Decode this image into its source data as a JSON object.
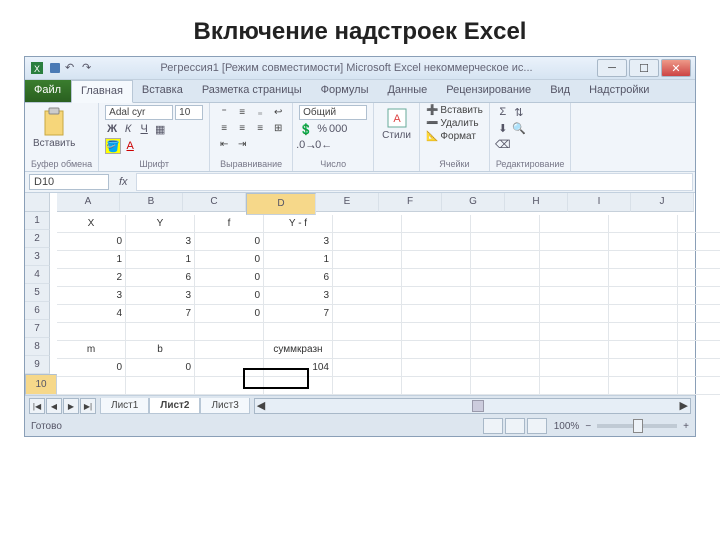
{
  "heading": "Включение надстроек Excel",
  "doctitle": "Регрессия1  [Режим совместимости]   Microsoft Excel некоммерческое ис...",
  "tabs": {
    "file": "Файл",
    "items": [
      "Главная",
      "Вставка",
      "Разметка страницы",
      "Формулы",
      "Данные",
      "Рецензирование",
      "Вид",
      "Надстройки"
    ]
  },
  "ribbon": {
    "clipboard": {
      "label": "Буфер обмена",
      "paste": "Вставить"
    },
    "font": {
      "label": "Шрифт",
      "name": "Adal cyr",
      "size": "10"
    },
    "align": {
      "label": "Выравнивание"
    },
    "number": {
      "label": "Число",
      "format": "Общий"
    },
    "styles": {
      "label": "Стили",
      "btn": "Стили"
    },
    "cells": {
      "label": "Ячейки",
      "insert": "Вставить",
      "delete": "Удалить",
      "format": "Формат"
    },
    "editing": {
      "label": "Редактирование"
    }
  },
  "namebox": "D10",
  "cols": [
    "A",
    "B",
    "C",
    "D",
    "E",
    "F",
    "G",
    "H",
    "I",
    "J"
  ],
  "rows": [
    "1",
    "2",
    "3",
    "4",
    "5",
    "6",
    "7",
    "8",
    "9",
    "10"
  ],
  "data": [
    [
      "X",
      "Y",
      "f",
      "Y - f",
      "",
      "",
      "",
      "",
      "",
      ""
    ],
    [
      "0",
      "3",
      "0",
      "3",
      "",
      "",
      "",
      "",
      "",
      ""
    ],
    [
      "1",
      "1",
      "0",
      "1",
      "",
      "",
      "",
      "",
      "",
      ""
    ],
    [
      "2",
      "6",
      "0",
      "6",
      "",
      "",
      "",
      "",
      "",
      ""
    ],
    [
      "3",
      "3",
      "0",
      "3",
      "",
      "",
      "",
      "",
      "",
      ""
    ],
    [
      "4",
      "7",
      "0",
      "7",
      "",
      "",
      "",
      "",
      "",
      ""
    ],
    [
      "",
      "",
      "",
      "",
      "",
      "",
      "",
      "",
      "",
      ""
    ],
    [
      "m",
      "b",
      "",
      "суммкразн",
      "",
      "",
      "",
      "",
      "",
      ""
    ],
    [
      "0",
      "0",
      "",
      "104",
      "",
      "",
      "",
      "",
      "",
      ""
    ],
    [
      "",
      "",
      "",
      "",
      "",
      "",
      "",
      "",
      "",
      ""
    ]
  ],
  "textcells": [
    [
      0,
      0
    ],
    [
      0,
      1
    ],
    [
      0,
      2
    ],
    [
      0,
      3
    ],
    [
      7,
      0
    ],
    [
      7,
      1
    ],
    [
      7,
      3
    ]
  ],
  "sheets": [
    "Лист1",
    "Лист2",
    "Лист3"
  ],
  "status": {
    "ready": "Готово",
    "zoom": "100%"
  }
}
